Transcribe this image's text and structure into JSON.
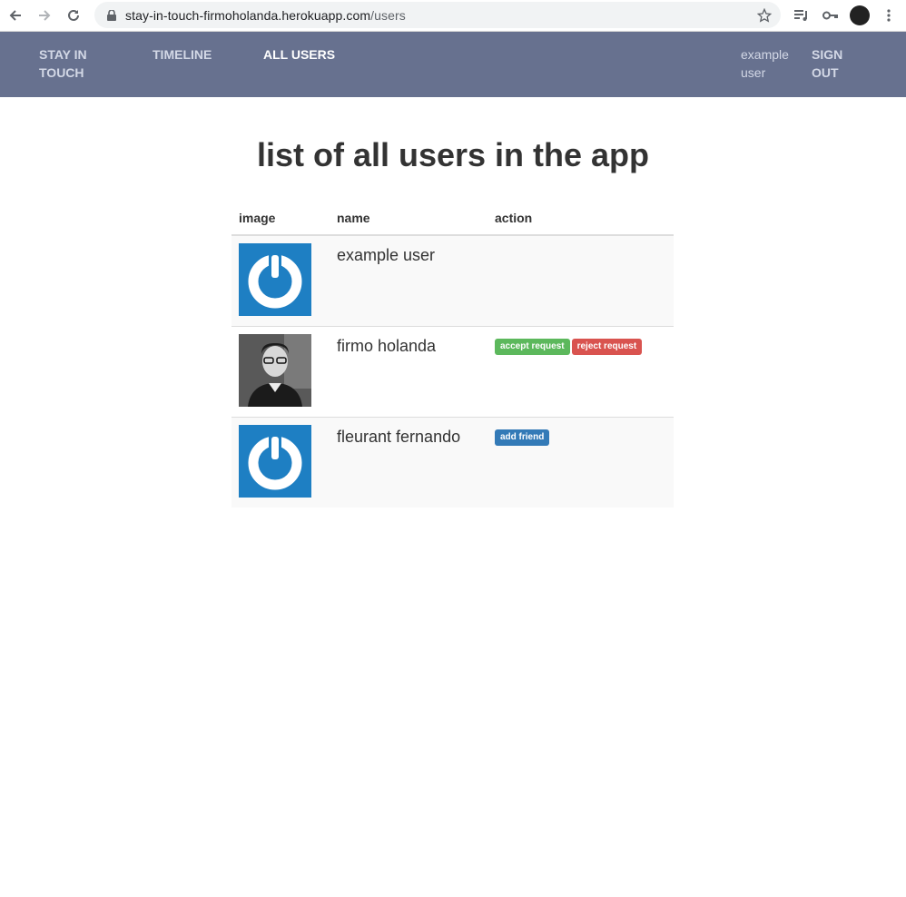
{
  "browser": {
    "url_host": "stay-in-touch-firmoholanda.herokuapp.com",
    "url_path": "/users"
  },
  "nav": {
    "brand_line1": "STAY IN",
    "brand_line2": "TOUCH",
    "timeline": "TIMELINE",
    "all_users": "ALL USERS",
    "user_line1": "example",
    "user_line2": "user",
    "signout_line1": "SIGN",
    "signout_line2": "OUT",
    "colors": {
      "bar": "#67718f",
      "link": "#d3d8e6",
      "active": "#ffffff"
    }
  },
  "page": {
    "title": "list of all users in the app"
  },
  "table": {
    "headers": [
      "image",
      "name",
      "action"
    ],
    "rows": [
      {
        "image": "gravatar-default-icon",
        "name": "example user",
        "actions": []
      },
      {
        "image": "user-photo",
        "name": "firmo holanda",
        "actions": [
          "accept request",
          "reject request"
        ]
      },
      {
        "image": "gravatar-default-icon",
        "name": "fleurant fernando",
        "actions": [
          "add friend"
        ]
      }
    ]
  },
  "colors": {
    "accept": "#5cb85c",
    "reject": "#d9534f",
    "add": "#337ab7",
    "gravatar": "#1e7fc3"
  }
}
